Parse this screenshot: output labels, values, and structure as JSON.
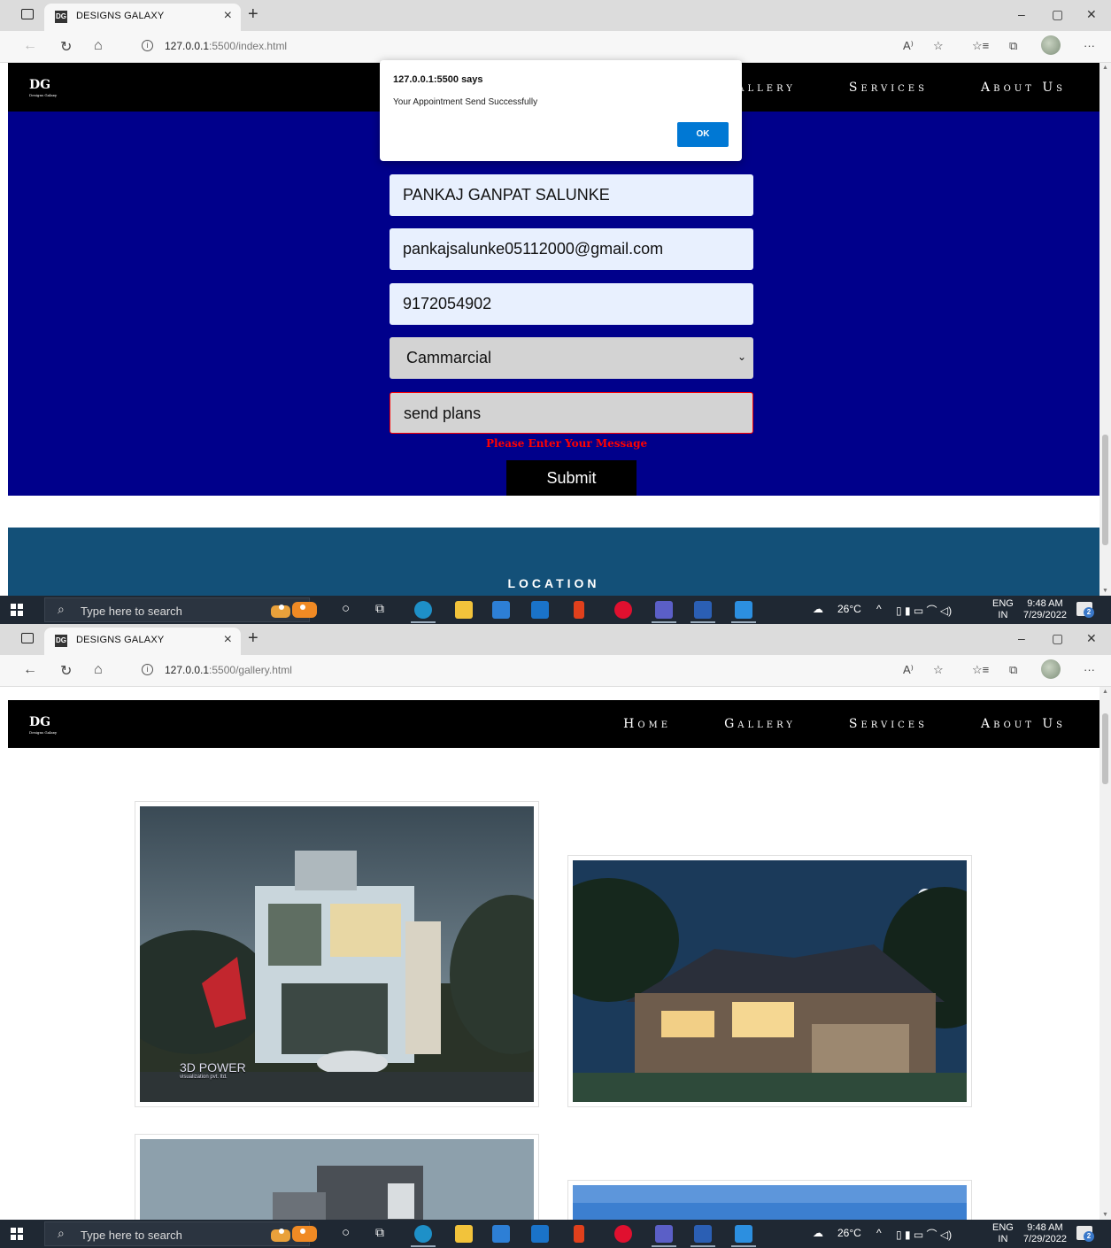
{
  "browser": {
    "tab_title": "DESIGNS GALAXY",
    "tab_close": "×",
    "new_tab": "+",
    "url_host": "127.0.0.1",
    "url_rest_index": ":5500/index.html",
    "url_rest_gallery": ":5500/gallery.html"
  },
  "site": {
    "logo": "DG",
    "logo_sub": "Designs Galaxy",
    "nav": {
      "home": "Home",
      "gallery": "Gallery",
      "services": "Services",
      "about": "About Us"
    }
  },
  "alert": {
    "title": "127.0.0.1:5500 says",
    "message": "Your Appointment Send Successfully",
    "ok": "OK"
  },
  "form": {
    "name": "PANKAJ GANPAT SALUNKE",
    "email": "pankajsalunke05112000@gmail.com",
    "phone": "9172054902",
    "type": "Cammarcial",
    "message": "send plans",
    "error": "Please Enter Your Message",
    "submit": "Submit"
  },
  "location_title": "LOCATION",
  "gallery": {
    "watermark": "3D POWER",
    "watermark_sub": "visualization pvt. ltd."
  },
  "taskbar": {
    "search_placeholder": "Type here to search",
    "weather": "26°C",
    "lang_top": "ENG",
    "lang_bottom": "IN",
    "time": "9:48 AM",
    "date": "7/29/2022",
    "notifications": "2"
  },
  "icons": [
    "window-icon",
    "favicon-icon",
    "back-icon",
    "refresh-icon",
    "home-icon",
    "info-icon",
    "read-aloud-icon",
    "favorite-icon",
    "favorites-icon",
    "collections-icon",
    "profile-icon",
    "more-icon",
    "windows-icon",
    "search-icon",
    "cortana-icon",
    "task-view-icon",
    "edge-icon",
    "explorer-icon",
    "store-icon",
    "mail-icon",
    "office-icon",
    "music-icon",
    "teams-icon",
    "word-icon",
    "vscode-icon",
    "cloud-icon",
    "chevron-up-icon",
    "notification-icon"
  ]
}
